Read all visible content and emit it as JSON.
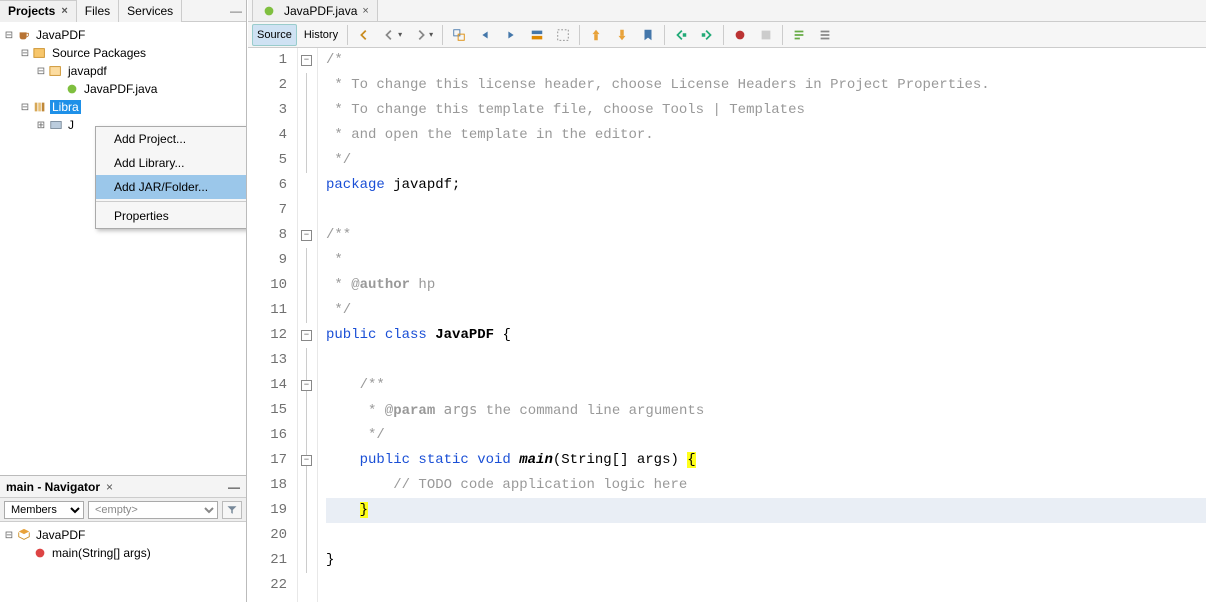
{
  "panelTabs": {
    "projects": "Projects",
    "files": "Files",
    "services": "Services"
  },
  "tree": {
    "root": "JavaPDF",
    "src": "Source Packages",
    "pkg": "javapdf",
    "file": "JavaPDF.java",
    "lib": "Libra",
    "jdk": "J"
  },
  "contextMenu": {
    "addProject": "Add Project...",
    "addLibrary": "Add Library...",
    "addJar": "Add JAR/Folder...",
    "properties": "Properties"
  },
  "navigator": {
    "title": "main - Navigator",
    "membersLabel": "Members",
    "emptyOpt": "<empty>",
    "cls": "JavaPDF",
    "method": "main(String[] args)"
  },
  "editor": {
    "tab": "JavaPDF.java",
    "sourceLabel": "Source",
    "historyLabel": "History"
  },
  "code": {
    "l1": "/*",
    "l2": " * To change this license header, choose License Headers in Project Properties.",
    "l3": " * To change this template file, choose Tools | Templates",
    "l4": " * and open the template in the editor.",
    "l5": " */",
    "l6a": "package",
    "l6b": " javapdf;",
    "l7": "",
    "l8": "/**",
    "l9": " *",
    "l10_a": " * @",
    "l10_b": "author",
    "l10_c": " hp",
    "l11": " */",
    "l12a": "public",
    "l12b": " class ",
    "l12c": "JavaPDF",
    "l12d": " {",
    "l13": "",
    "l14": "    /**",
    "l15a": "     * @",
    "l15b": "param",
    "l15c": " args",
    "l15d": " the command line arguments",
    "l16": "     */",
    "l17a": "    public",
    "l17b": " static",
    "l17c": " void ",
    "l17d": "main",
    "l17e": "(String[] args) ",
    "l17f": "{",
    "l18": "        // TODO code application logic here",
    "l19a": "    ",
    "l19b": "}",
    "l20": "",
    "l21": "}",
    "l22": ""
  }
}
